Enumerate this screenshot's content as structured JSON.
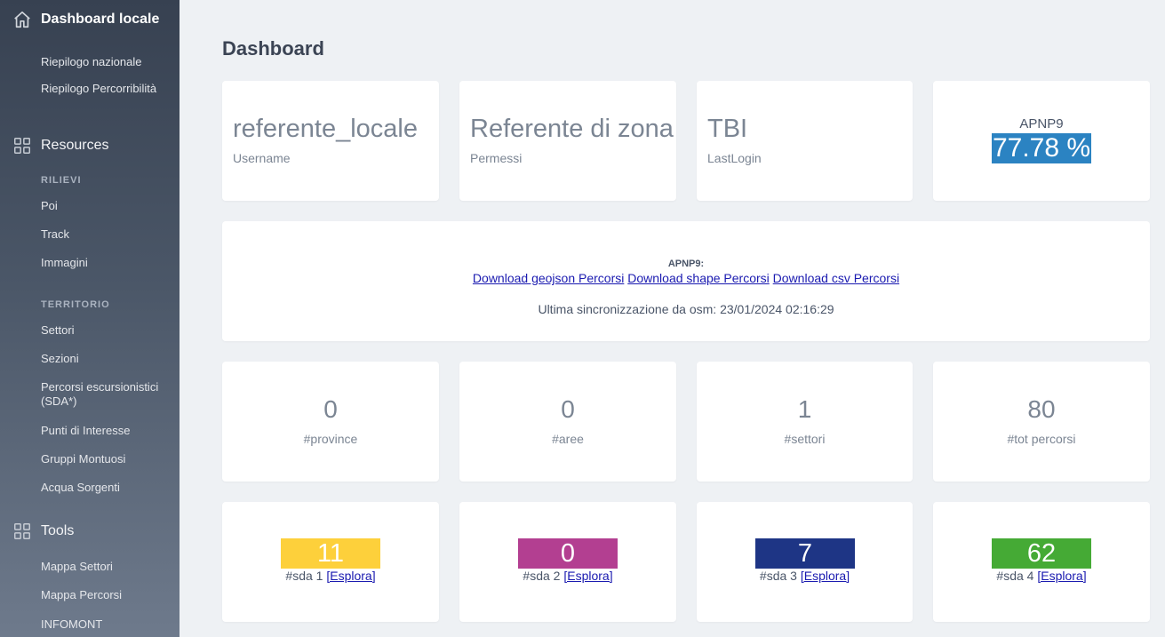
{
  "sidebar": {
    "dashboard_label": "Dashboard locale",
    "dashboard_items": [
      "Riepilogo nazionale",
      "Riepilogo Percorribilità"
    ],
    "resources_label": "Resources",
    "rilievi_title": "RILIEVI",
    "rilievi_items": [
      "Poi",
      "Track",
      "Immagini"
    ],
    "territorio_title": "TERRITORIO",
    "territorio_items": [
      "Settori",
      "Sezioni",
      "Percorsi escursionistici (SDA*)",
      "Punti di Interesse",
      "Gruppi Montuosi",
      "Acqua Sorgenti"
    ],
    "tools_label": "Tools",
    "tools_items": [
      "Mappa Settori",
      "Mappa Percorsi",
      "INFOMONT"
    ]
  },
  "main": {
    "title": "Dashboard",
    "user_cards": [
      {
        "value": "referente_locale",
        "label": "Username"
      },
      {
        "value": "Referente di zona",
        "label": "Permessi"
      },
      {
        "value": "TBI",
        "label": "LastLogin"
      }
    ],
    "apnp": {
      "title": "APNP9",
      "percent": "77.78 %",
      "color": "#2b83c2"
    },
    "downloads": {
      "heading": "APNP9:",
      "geojson": "Download geojson Percorsi",
      "shape": "Download shape Percorsi",
      "csv": "Download csv Percorsi",
      "sync": "Ultima sincronizzazione da osm: 23/01/2024 02:16:29"
    },
    "stats": [
      {
        "value": "0",
        "label": "#province"
      },
      {
        "value": "0",
        "label": "#aree"
      },
      {
        "value": "1",
        "label": "#settori"
      },
      {
        "value": "80",
        "label": "#tot percorsi"
      }
    ],
    "sda": [
      {
        "value": "11",
        "label": "#sda 1",
        "link": "[Esplora]",
        "color": "#fdd03b"
      },
      {
        "value": "0",
        "label": "#sda 2",
        "link": "[Esplora]",
        "color": "#b33f91"
      },
      {
        "value": "7",
        "label": "#sda 3",
        "link": "[Esplora]",
        "color": "#1e3585"
      },
      {
        "value": "62",
        "label": "#sda 4",
        "link": "[Esplora]",
        "color": "#45aa35"
      }
    ]
  }
}
